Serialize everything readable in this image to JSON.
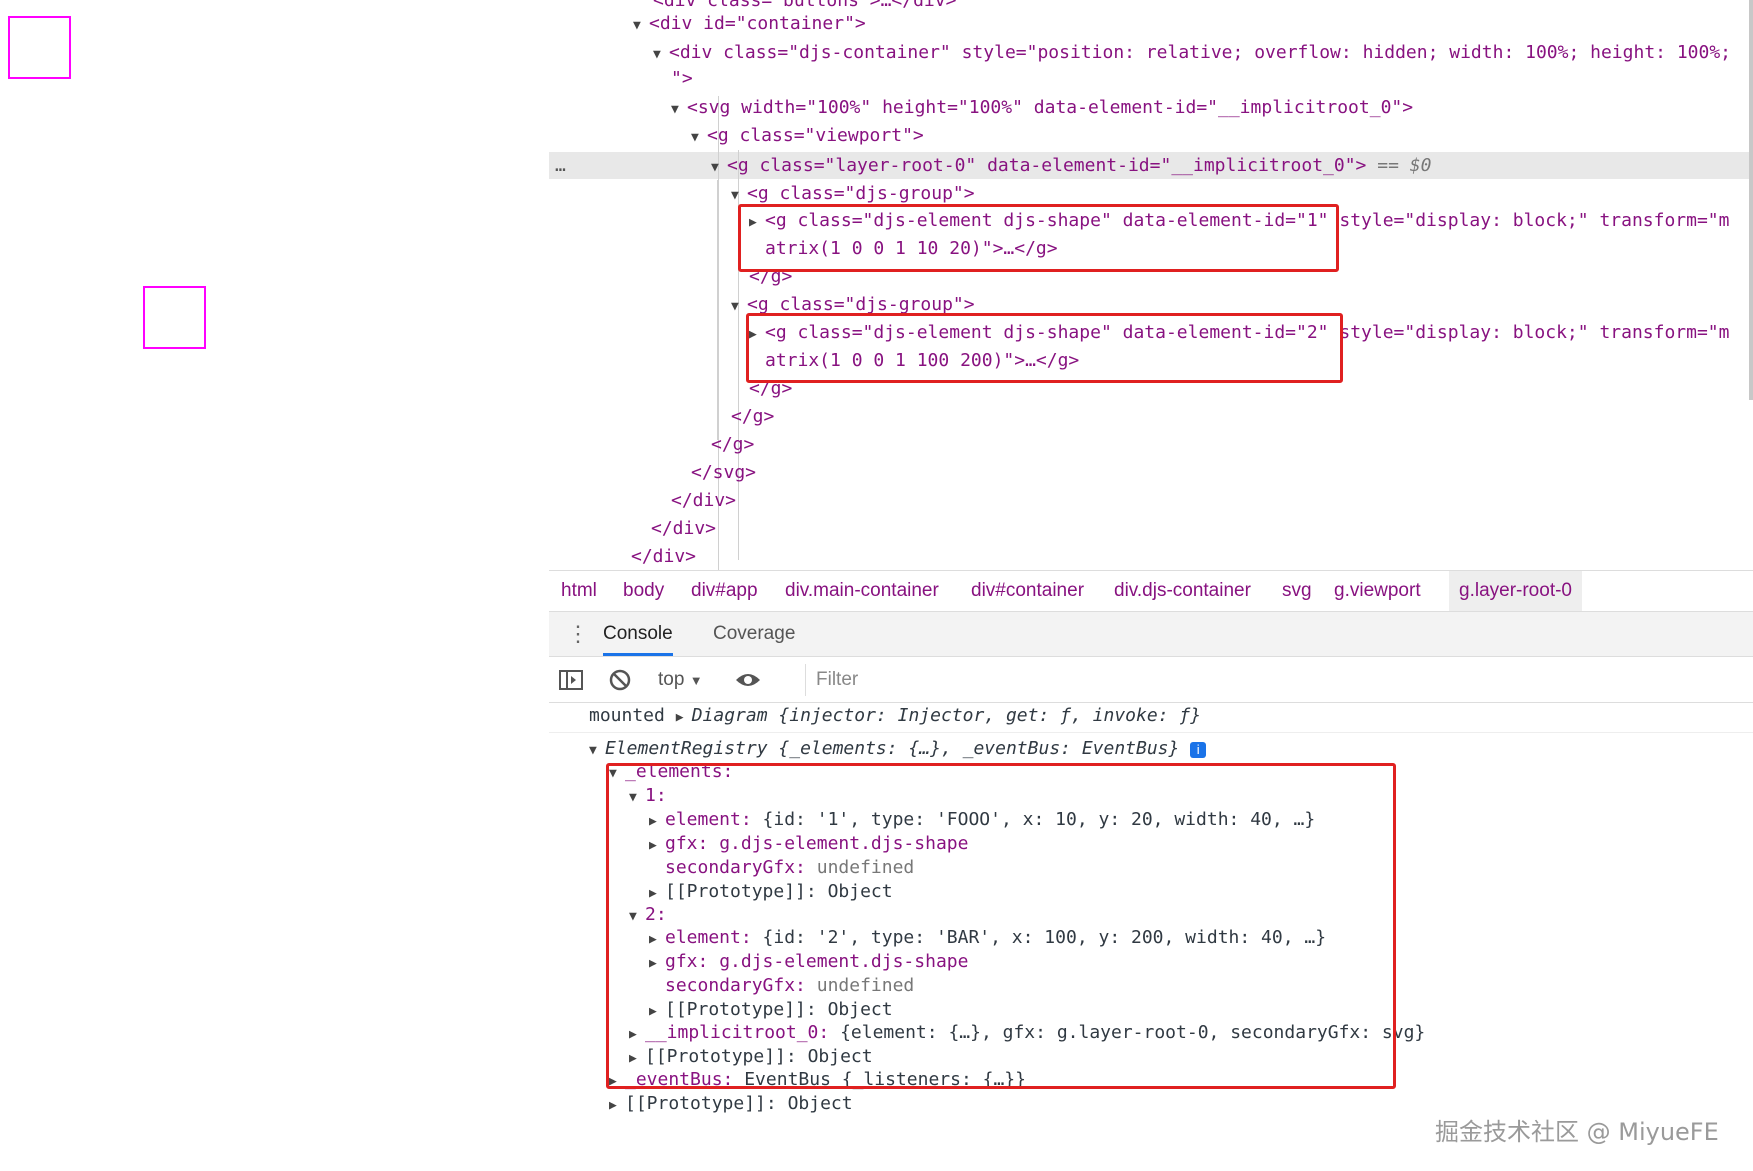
{
  "canvas": {
    "shape_color": "#ff00ff"
  },
  "elements_panel": {
    "line0": "<div class=\"buttons\">…</div>",
    "line1": "<div id=\"container\">",
    "line2": "<div class=\"djs-container\" style=\"position: relative; overflow: hidden; width: 100%; height: 100%;",
    "line2b": "\">",
    "line3": "<svg width=\"100%\" height=\"100%\" data-element-id=\"__implicitroot_0\">",
    "line4": "<g class=\"viewport\">",
    "line5": "<g class=\"layer-root-0\" data-element-id=\"__implicitroot_0\">",
    "line5_suffix": "== $0",
    "line6": "<g class=\"djs-group\">",
    "line7a": "<g class=\"djs-element djs-shape\" data-element-id=\"1\" style=\"display: block;\" transform=\"m",
    "line7b": "atrix(1 0 0 1 10 20)\">…</g>",
    "line8": "</g>",
    "line9": "<g class=\"djs-group\">",
    "line10a": "<g class=\"djs-element djs-shape\" data-element-id=\"2\" style=\"display: block;\" transform=\"m",
    "line10b": "atrix(1 0 0 1 100 200)\">…</g>",
    "line11": "</g>",
    "line12": "</g>",
    "line13": "</g>",
    "line14": "</svg>",
    "line15": "</div>",
    "line16": "</div>",
    "line17": "</div>",
    "dots": "…"
  },
  "breadcrumbs": [
    "html",
    "body",
    "div#app",
    "div.main-container",
    "div#container",
    "div.djs-container",
    "svg",
    "g.viewport",
    "g.layer-root-0"
  ],
  "drawer_tabs": [
    "Console",
    "Coverage"
  ],
  "console_toolbar": {
    "context": "top",
    "filter_placeholder": "Filter"
  },
  "console": {
    "l1_prefix": "mounted",
    "l1_obj": "Diagram {injector: Injector, get: ƒ, invoke: ƒ}",
    "l2": "ElementRegistry {_elements: {…}, _eventBus: EventBus}",
    "l3": "_elements:",
    "l4": "1:",
    "l5_key": "element:",
    "l5_val": "{id: '1', type: 'FOOO', x: 10, y: 20, width: 40, …}",
    "l6_key": "gfx:",
    "l6_val": "g.djs-element.djs-shape",
    "l7_key": "secondaryGfx:",
    "l7_val": "undefined",
    "l8_key": "[[Prototype]]:",
    "l8_val": "Object",
    "l9": "2:",
    "l10_key": "element:",
    "l10_val": "{id: '2', type: 'BAR', x: 100, y: 200, width: 40, …}",
    "l11_key": "gfx:",
    "l11_val": "g.djs-element.djs-shape",
    "l12_key": "secondaryGfx:",
    "l12_val": "undefined",
    "l13_key": "[[Prototype]]:",
    "l13_val": "Object",
    "l14_key": "__implicitroot_0:",
    "l14_val": "{element: {…}, gfx: g.layer-root-0, secondaryGfx: svg}",
    "l15_key": "[[Prototype]]:",
    "l15_val": "Object",
    "l16_key": "_eventBus:",
    "l16_val": "EventBus {_listeners: {…}}",
    "l17_key": "[[Prototype]]:",
    "l17_val": "Object"
  },
  "watermark": "掘金技术社区 @ MiyueFE"
}
